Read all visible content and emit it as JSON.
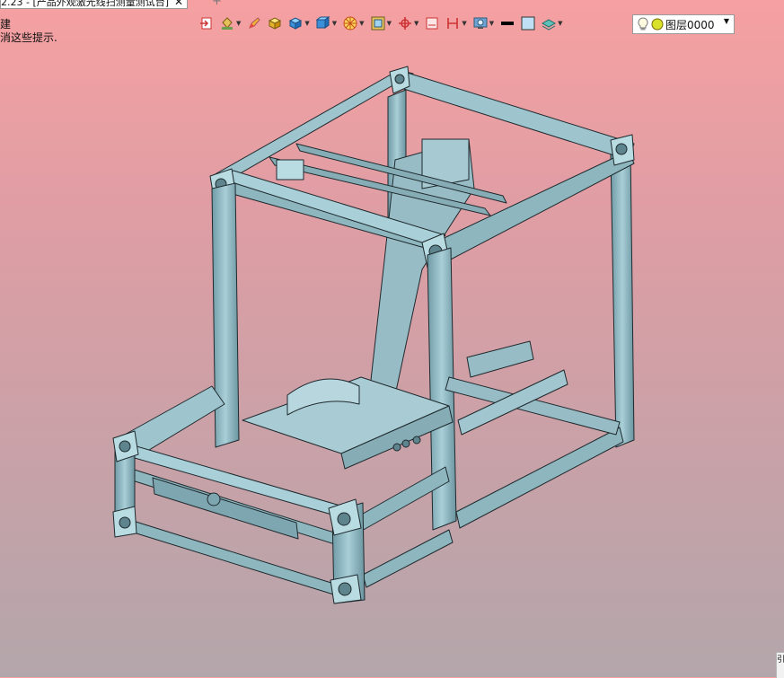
{
  "window": {
    "tab_title": "2.23 - [产品外观激光线扫测量测试台]",
    "tab_close_glyph": "✕",
    "tab_add_glyph": "+"
  },
  "hints": {
    "line1": "建",
    "line2": "消这些提示."
  },
  "toolbar": {
    "tools": [
      {
        "name": "exit-sketch-icon",
        "has_dropdown": false
      },
      {
        "name": "paint-bucket-icon",
        "has_dropdown": true
      },
      {
        "name": "pencil-icon",
        "has_dropdown": false
      },
      {
        "name": "solid-yellow-cube-icon",
        "has_dropdown": false
      },
      {
        "name": "solid-blue-cube-icon",
        "has_dropdown": true
      },
      {
        "name": "view-orientation-icon",
        "has_dropdown": true
      },
      {
        "name": "section-view-icon",
        "has_dropdown": true
      },
      {
        "name": "zoom-box-icon",
        "has_dropdown": true
      },
      {
        "name": "rotate-view-icon",
        "has_dropdown": true
      },
      {
        "name": "plane-icon",
        "has_dropdown": false
      },
      {
        "name": "dimension-icon",
        "has_dropdown": true
      },
      {
        "name": "display-settings-icon",
        "has_dropdown": true
      },
      {
        "name": "line-color-icon",
        "has_dropdown": false
      },
      {
        "name": "face-color-icon",
        "has_dropdown": false
      },
      {
        "name": "layer-manager-icon",
        "has_dropdown": true
      }
    ],
    "layer_select": {
      "value": "图层0000"
    }
  },
  "colors": {
    "bg_top": "#f6a0a2",
    "bg_bottom": "#b3a6ab",
    "model_fill": "#8db6c0",
    "model_edge": "#1e2a2e"
  },
  "scroll_corner_text": "引"
}
